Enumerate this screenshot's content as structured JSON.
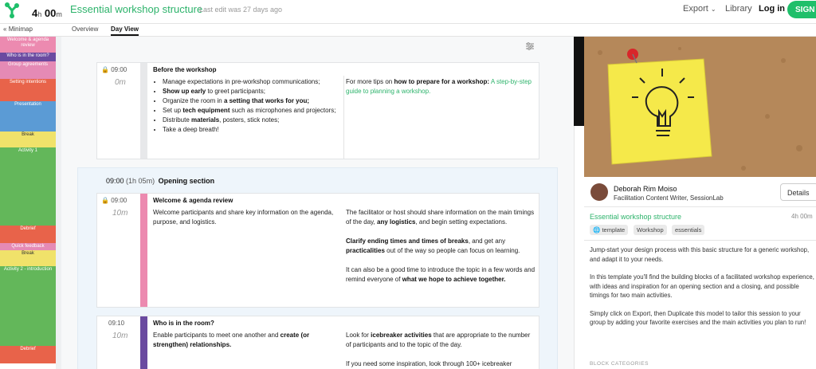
{
  "header": {
    "duration_hours": "4",
    "duration_h_unit": "h",
    "duration_minutes": "00",
    "duration_m_unit": "m",
    "title": "Essential workshop structure",
    "last_edit": "Last edit was 27 days ago",
    "export": "Export",
    "library": "Library",
    "login": "Log in",
    "signup": "SIGN U"
  },
  "tabs": {
    "minimap": "Minimap",
    "overview": "Overview",
    "dayview": "Day View"
  },
  "minimap": [
    {
      "label": "Welcome & agenda review",
      "color": "#ec8ab0"
    },
    {
      "label": "Who is in the room?",
      "color": "#6a4aa0"
    },
    {
      "label": "Group agreements",
      "color": "#e58ab5"
    },
    {
      "label": "Setting intentions",
      "color": "#e8634a"
    },
    {
      "label": "Presentation",
      "color": "#5b9bd5"
    },
    {
      "label": "Break",
      "color": "#f0e26a"
    },
    {
      "label": "Activity 1",
      "color": "#63b75a"
    },
    {
      "label": "Debrief",
      "color": "#e8634a"
    },
    {
      "label": "Quick feedback",
      "color": "#e58ab5"
    },
    {
      "label": "Break",
      "color": "#f0e26a"
    },
    {
      "label": "Activity 2 - introduction",
      "color": "#63b75a"
    },
    {
      "label": "Debrief",
      "color": "#e8634a"
    }
  ],
  "before": {
    "time": "09:00",
    "dur": "0m",
    "title": "Before the workshop",
    "bullets": [
      [
        "Manage expectations in pre-workshop communications;",
        "",
        ""
      ],
      [
        "",
        "Show up early",
        " to greet participants;"
      ],
      [
        "Organize the room in ",
        "a setting that works for you;",
        ""
      ],
      [
        "Set up ",
        "tech equipment",
        " such as microphones and projectors;"
      ],
      [
        "Distribute ",
        "materials",
        ", posters, stick notes;"
      ],
      [
        "Take a deep breath!",
        "",
        ""
      ]
    ],
    "tip_pre": "For more tips on ",
    "tip_bold": "how to prepare for a workshop:",
    "tip_link": "A step-by-step guide to planning a workshop."
  },
  "section": {
    "time": "09:00",
    "dur": "(1h 05m)",
    "name": "Opening section"
  },
  "welcome": {
    "time": "09:00",
    "dur": "10m",
    "title": "Welcome & agenda review",
    "color": "#ec8ab0",
    "left": "Welcome participants and share key information on the agenda, purpose, and logistics.",
    "r1_pre": "The facilitator or host should share information on the main timings of the day, ",
    "r1_bold": "any logistics",
    "r1_post": ", and begin setting expectations.",
    "r2_bold": "Clarify ending times and times of breaks",
    "r2_mid": ", and get any ",
    "r2_bold2": "practicalities",
    "r2_post": " out of the way so people can focus on learning.",
    "r3_pre": "It can also be a good time to introduce the topic in a few words and remind everyone of ",
    "r3_bold": "what we hope to achieve together."
  },
  "who": {
    "time": "09:10",
    "dur": "10m",
    "title": "Who is in the room?",
    "color": "#6a4aa0",
    "left_pre": "Enable participants to meet one another and ",
    "left_bold": "create (or strengthen) relationships.",
    "r1_pre": "Look for ",
    "r1_bold": "icebreaker activities",
    "r1_post": " that are appropriate to the number of participants and to the topic of the day.",
    "r2": "If you need some inspiration, look through 100+ icebreaker"
  },
  "panel": {
    "author": "Deborah Rim Moiso",
    "role": "Facilitation Content Writer, SessionLab",
    "details": "Details",
    "title": "Essential workshop structure",
    "dur": "4h 00m",
    "tags": [
      "template",
      "Workshop",
      "essentials"
    ],
    "p1": "Jump-start your design process with this basic structure for a generic workshop,  and adapt it to your needs.",
    "p2": "In this template you'll find the building blocks of a facilitated workshop experience, with ideas and inspiration for an opening section and a closing, and possible timings for two main activities.",
    "p3": "Simply click on Export, then Duplicate this model to tailor this session to your group by adding your favorite exercises and the main activities you plan to run!",
    "blockcat": "BLOCK CATEGORIES"
  },
  "colors": {
    "brand": "#2db36b",
    "signup": "#1fbf6a"
  }
}
